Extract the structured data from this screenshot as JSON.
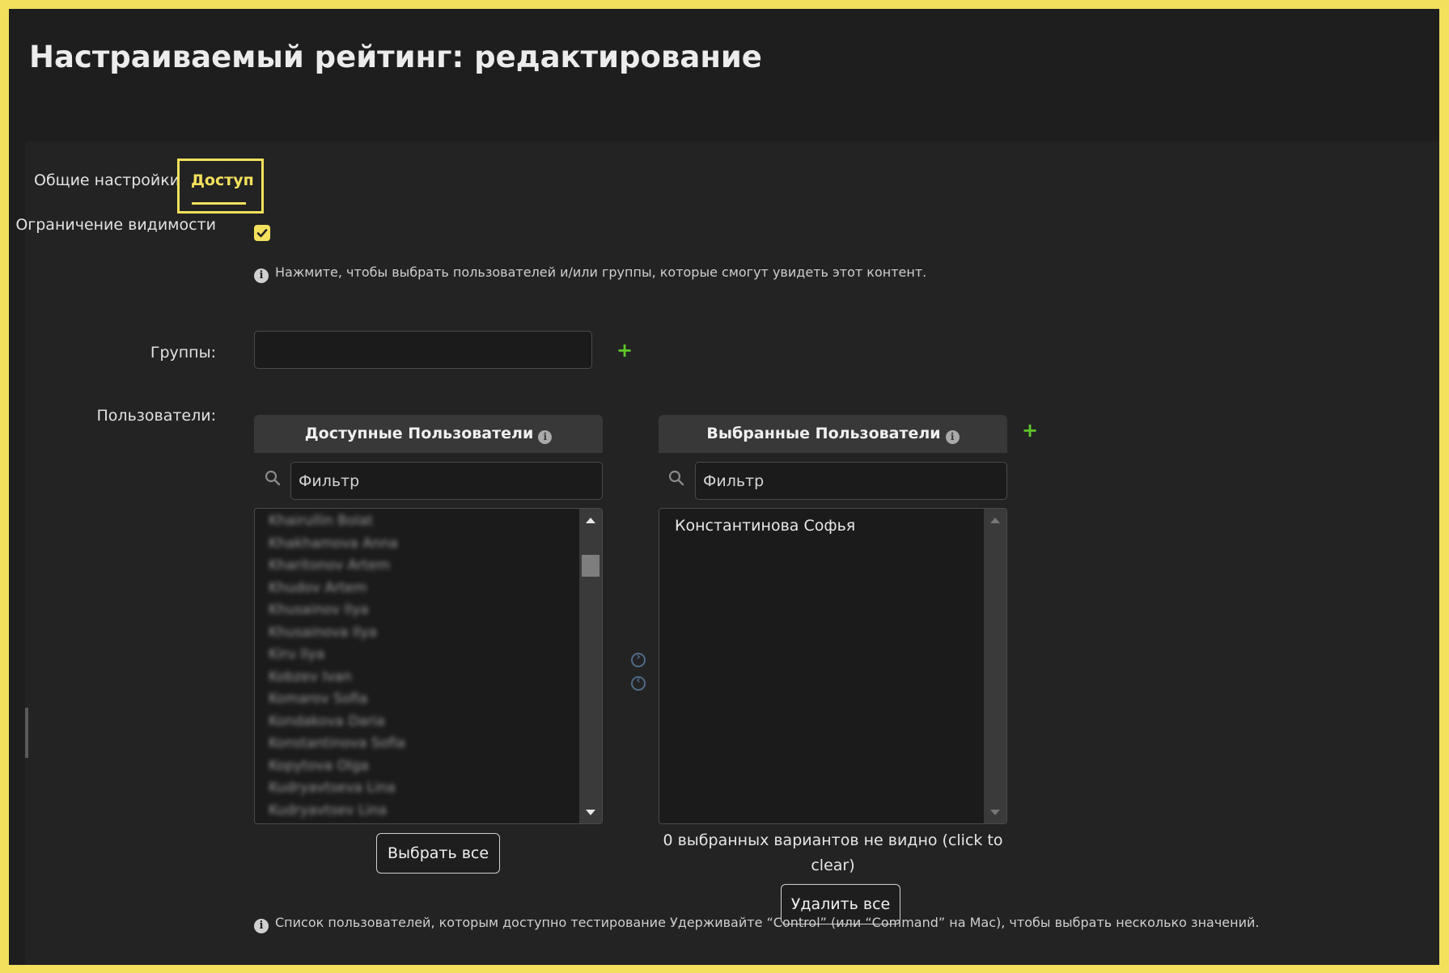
{
  "page": {
    "title": "Настраиваемый рейтинг: редактирование"
  },
  "tabs": [
    {
      "label": "Общие настройки",
      "active": false
    },
    {
      "label": "Доступ",
      "active": true
    }
  ],
  "visibility": {
    "label": "Ограничение видимости",
    "checked": true,
    "help_text": "Нажмите, чтобы выбрать пользователей и/или группы, которые смогут увидеть этот контент."
  },
  "groups": {
    "label": "Группы:",
    "value": ""
  },
  "users": {
    "label": "Пользователи:",
    "available": {
      "title": "Доступные Пользователи",
      "filter_placeholder": "Фильтр",
      "items": [
        "Khairullin Bolat",
        "Khakhamova Anna",
        "Kharitonov Artem",
        "Khudov Artem",
        "Khusainov Ilya",
        "Khusainova Ilya",
        "Kiru Ilya",
        "Kobzev Ivan",
        "Komarov Sofia",
        "Kondakova Daria",
        "Konstantinova Sofia",
        "Kopytova Olga",
        "Kudryavtseva Lina",
        "Kudryavtsev Lina"
      ],
      "select_all_label": "Выбрать все"
    },
    "chosen": {
      "title": "Выбранные Пользователи",
      "filter_placeholder": "Фильтр",
      "items": [
        "Константинова Софья"
      ],
      "hidden_note": "0 выбранных вариантов не видно (click to clear)",
      "remove_all_label": "Удалить все"
    },
    "help_text": "Список пользователей, которым доступно тестирование Удерживайте “Control” (или “Command” на Mac), чтобы выбрать несколько значений."
  },
  "icons": {
    "info": "info-icon",
    "search": "search-icon",
    "add": "plus-icon",
    "move_right": "arrow-right-circle-icon",
    "move_left": "arrow-left-circle-icon"
  },
  "colors": {
    "accent": "#f3e05c",
    "add": "#5fc62a",
    "background": "#1e1e1e"
  }
}
